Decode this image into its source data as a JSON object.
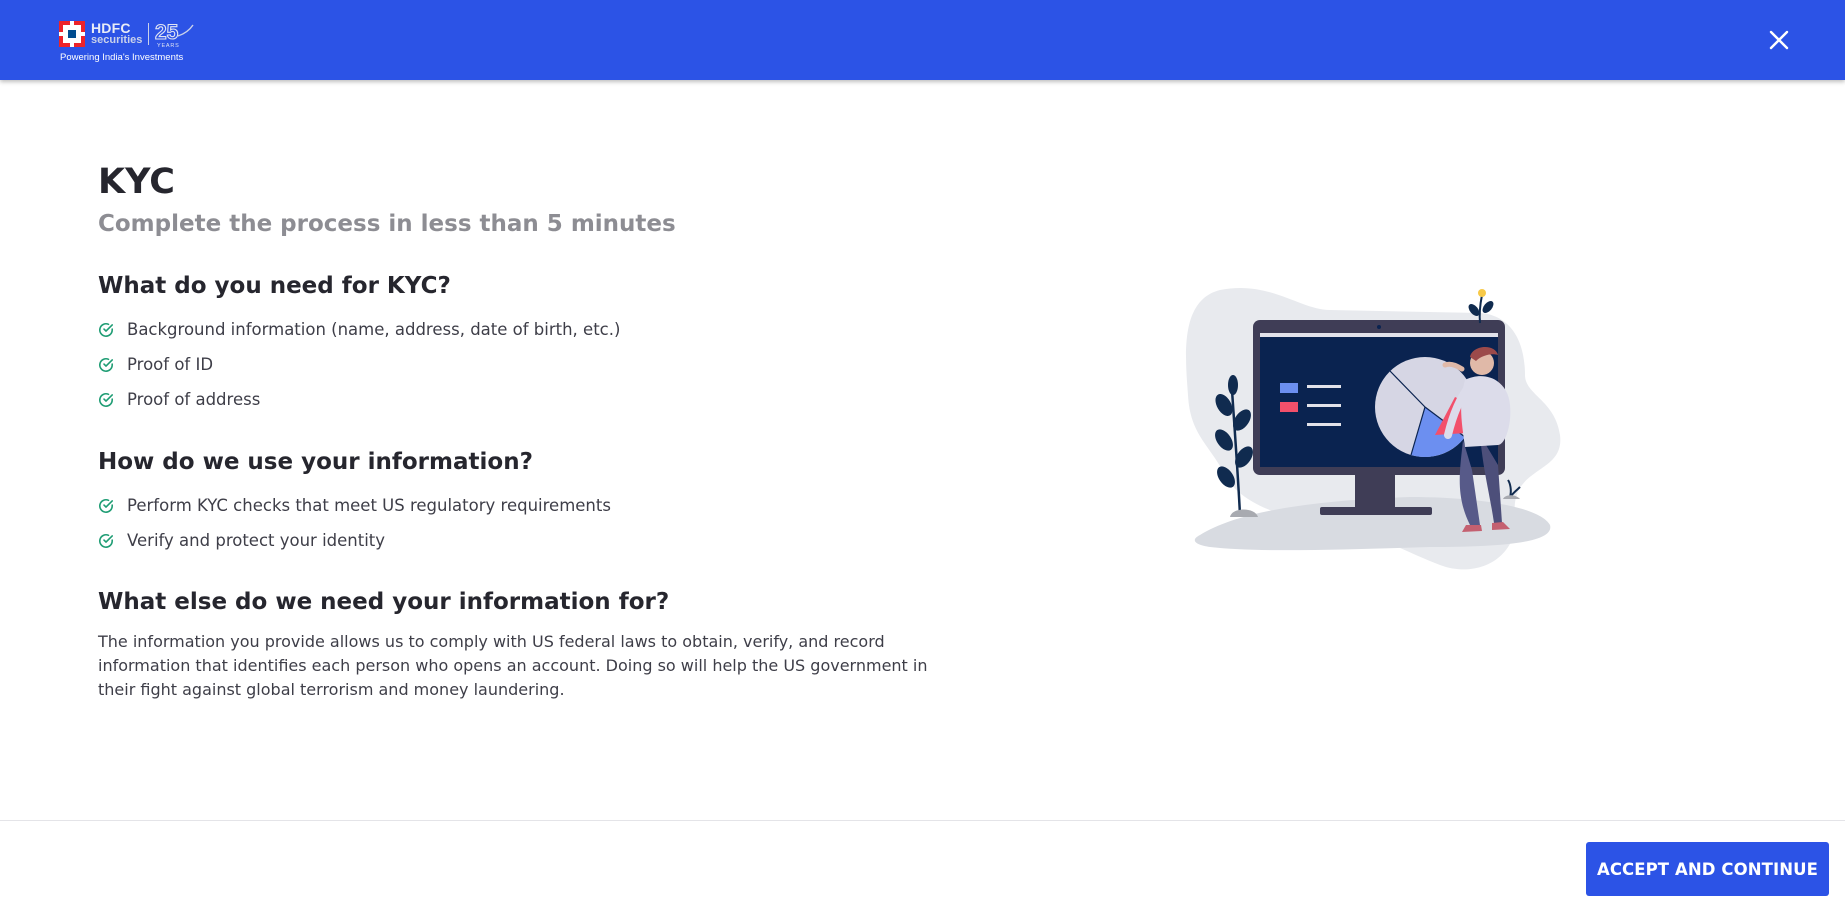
{
  "header": {
    "logo": {
      "brand": "HDFC",
      "sub": "securities",
      "years": "25 YEARS",
      "tagline": "Powering India's Investments"
    },
    "close_icon": "close-icon"
  },
  "main": {
    "title": "KYC",
    "subtitle": "Complete the process in less than 5 minutes",
    "sections": [
      {
        "heading": "What do you need for KYC?",
        "items": [
          "Background information (name, address, date of birth, etc.)",
          "Proof of ID",
          "Proof of address"
        ]
      },
      {
        "heading": "How do we use your information?",
        "items": [
          "Perform KYC checks that meet US regulatory requirements",
          "Verify and protect your identity"
        ]
      },
      {
        "heading": "What else do we need your information for?",
        "text": "The information you provide allows us to comply with US federal laws to obtain, verify, and record information that identifies each person who opens an account. Doing so will help the US government in their fight against global terrorism and money laundering."
      }
    ]
  },
  "illustration": {
    "icon": "data-analysis-illustration"
  },
  "footer": {
    "accept_label": "ACCEPT AND CONTINUE"
  },
  "colors": {
    "primary": "#2c53e6",
    "check": "#1f9d74",
    "heading": "#26262e",
    "muted": "#8d8d93"
  }
}
